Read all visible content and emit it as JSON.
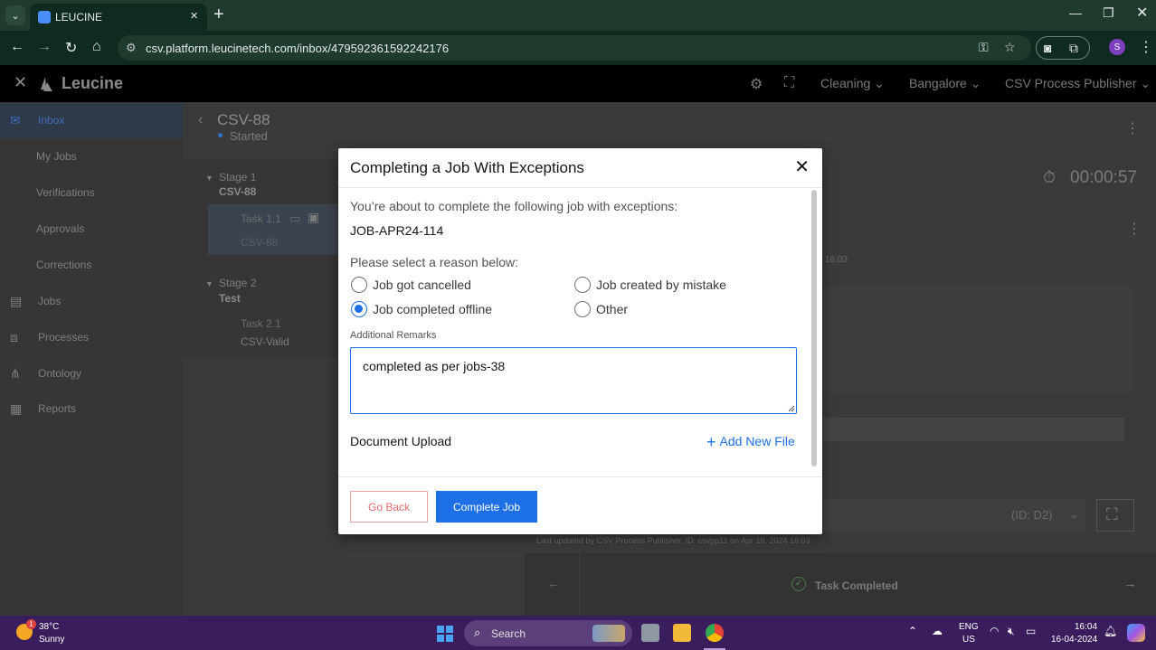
{
  "browser": {
    "tab_title": "LEUCINE",
    "url": "csv.platform.leucinetech.com/inbox/479592361592242176",
    "profile_initial": "S"
  },
  "app": {
    "logo": "Leucine",
    "menus": [
      "Cleaning",
      "Bangalore",
      "CSV Process Publisher"
    ]
  },
  "sidebar": {
    "items": [
      {
        "label": "Inbox",
        "icon": "inbox-icon",
        "active": true
      },
      {
        "label": "My Jobs"
      },
      {
        "label": "Verifications"
      },
      {
        "label": "Approvals"
      },
      {
        "label": "Corrections"
      },
      {
        "label": "Jobs",
        "icon": "clipboard-icon"
      },
      {
        "label": "Processes",
        "icon": "flow-icon"
      },
      {
        "label": "Ontology",
        "icon": "hierarchy-icon"
      },
      {
        "label": "Reports",
        "icon": "report-icon"
      }
    ]
  },
  "job": {
    "title": "CSV-88",
    "status": "Started",
    "timer": "00:00:57",
    "stages": [
      {
        "label": "Stage 1",
        "name": "CSV-88",
        "task_label": "Task 1.1",
        "task_name": "CSV-88"
      },
      {
        "label": "Stage 2",
        "name": "Test",
        "task_label": "Task 2.1",
        "task_name": "CSV-Valid"
      }
    ],
    "bg_timestamp_short": "16:03",
    "bg_id": "(ID: D2)",
    "last_updated": "Last updated by CSV Process Publisher, ID: csvpp11 on Apr 16, 2024 16:03",
    "task_completed": "Task Completed"
  },
  "modal": {
    "title": "Completing a Job With Exceptions",
    "intro": "You’re about to complete the following job with exceptions:",
    "job_id": "JOB-APR24-114",
    "reason_prompt": "Please select a reason below:",
    "reasons": [
      {
        "label": "Job got cancelled",
        "checked": false
      },
      {
        "label": "Job created by mistake",
        "checked": false
      },
      {
        "label": "Job completed offline",
        "checked": true
      },
      {
        "label": "Other",
        "checked": false
      }
    ],
    "remarks_label": "Additional Remarks",
    "remarks_value": "completed as per jobs-38",
    "doc_label": "Document Upload",
    "add_file_label": "Add New File",
    "go_back_label": "Go Back",
    "complete_label": "Complete Job",
    "accent": "#1d6fe6"
  },
  "taskbar": {
    "temperature": "38°C",
    "condition": "Sunny",
    "weather_badge": "1",
    "search_label": "Search",
    "lang_line1": "ENG",
    "lang_line2": "US",
    "time": "16:04",
    "date": "16-04-2024"
  }
}
